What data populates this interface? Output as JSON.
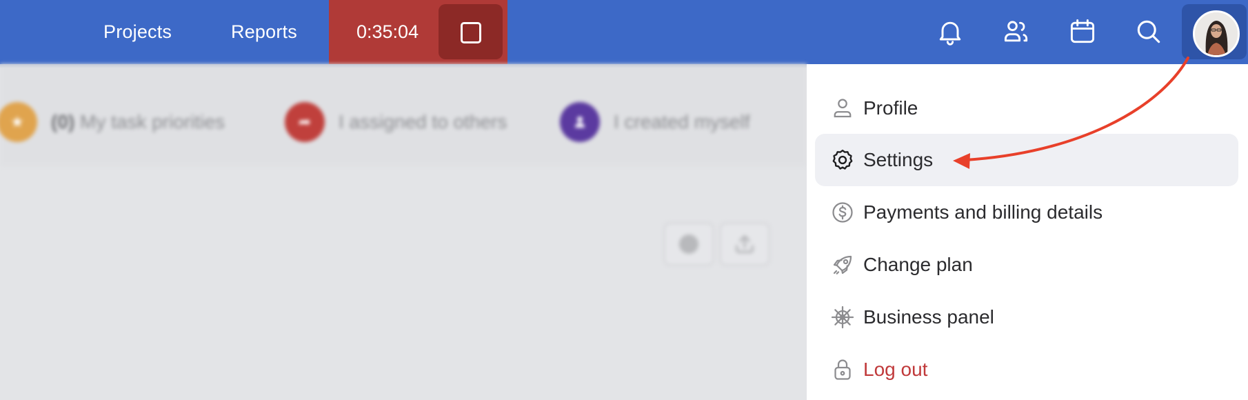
{
  "topbar": {
    "nav": [
      {
        "label": "Projects"
      },
      {
        "label": "Reports"
      }
    ],
    "timer": {
      "value": "0:35:04",
      "stop_icon": "stop-square-icon"
    },
    "icons": [
      {
        "name": "bell-icon"
      },
      {
        "name": "team-icon"
      },
      {
        "name": "calendar-icon"
      },
      {
        "name": "search-icon"
      }
    ],
    "avatar": {
      "name": "user-avatar"
    },
    "colors": {
      "bar": "#3d69c7",
      "timer": "#b03a37",
      "stop": "#8c2926"
    }
  },
  "filters": [
    {
      "count": "(0)",
      "label": "My task priorities",
      "color": "#e0a44e",
      "icon": "star-icon"
    },
    {
      "label": "I assigned to others",
      "color": "#c0403c",
      "icon": "share-arrow-icon"
    },
    {
      "label": "I created myself",
      "color": "#5b3aa0",
      "icon": "person-icon"
    }
  ],
  "toolbar": {
    "buttons": [
      {
        "icon": "circle-icon"
      },
      {
        "icon": "upload-icon"
      }
    ]
  },
  "user_menu": {
    "items": [
      {
        "label": "Profile",
        "icon": "user-icon",
        "active": false
      },
      {
        "label": "Settings",
        "icon": "gear-icon",
        "active": true
      },
      {
        "label": "Payments and billing details",
        "icon": "dollar-circle-icon",
        "active": false
      },
      {
        "label": "Change plan",
        "icon": "rocket-icon",
        "active": false
      },
      {
        "label": "Business panel",
        "icon": "helm-icon",
        "active": false
      },
      {
        "label": "Log out",
        "icon": "lock-icon",
        "active": false,
        "danger": true
      }
    ]
  },
  "annotation": {
    "type": "arrow",
    "from": "avatar",
    "to": "Settings",
    "color": "#e8402a"
  }
}
